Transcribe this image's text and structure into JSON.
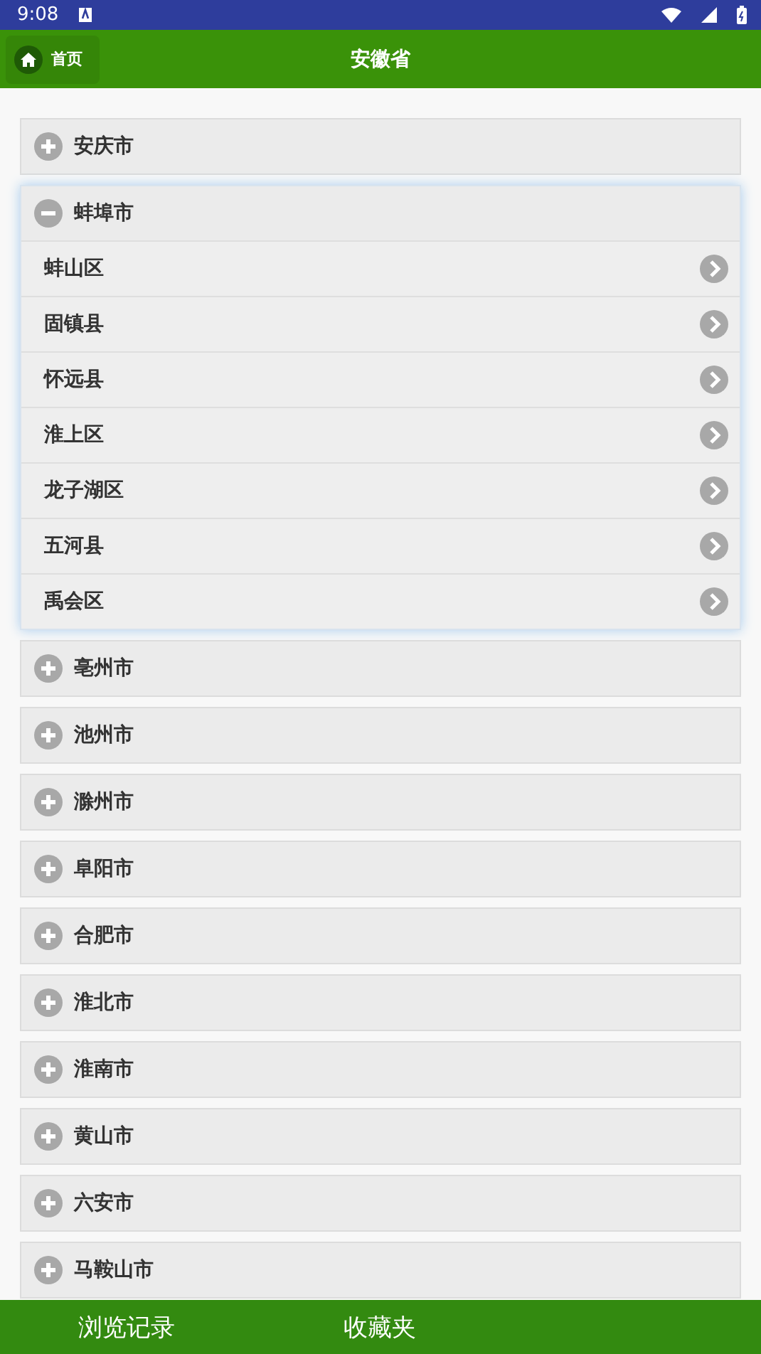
{
  "status_bar": {
    "time": "9:08"
  },
  "header": {
    "home_button": "首页",
    "title": "安徽省"
  },
  "cities": [
    {
      "name": "安庆市",
      "expanded": false
    },
    {
      "name": "蚌埠市",
      "expanded": true,
      "children": [
        {
          "name": "蚌山区"
        },
        {
          "name": "固镇县"
        },
        {
          "name": "怀远县"
        },
        {
          "name": "淮上区"
        },
        {
          "name": "龙子湖区"
        },
        {
          "name": "五河县"
        },
        {
          "name": "禹会区"
        }
      ]
    },
    {
      "name": "亳州市",
      "expanded": false
    },
    {
      "name": "池州市",
      "expanded": false
    },
    {
      "name": "滁州市",
      "expanded": false
    },
    {
      "name": "阜阳市",
      "expanded": false
    },
    {
      "name": "合肥市",
      "expanded": false
    },
    {
      "name": "淮北市",
      "expanded": false
    },
    {
      "name": "淮南市",
      "expanded": false
    },
    {
      "name": "黄山市",
      "expanded": false
    },
    {
      "name": "六安市",
      "expanded": false
    },
    {
      "name": "马鞍山市",
      "expanded": false
    }
  ],
  "bottom_nav": [
    {
      "label": "浏览记录"
    },
    {
      "label": "收藏夹"
    }
  ]
}
